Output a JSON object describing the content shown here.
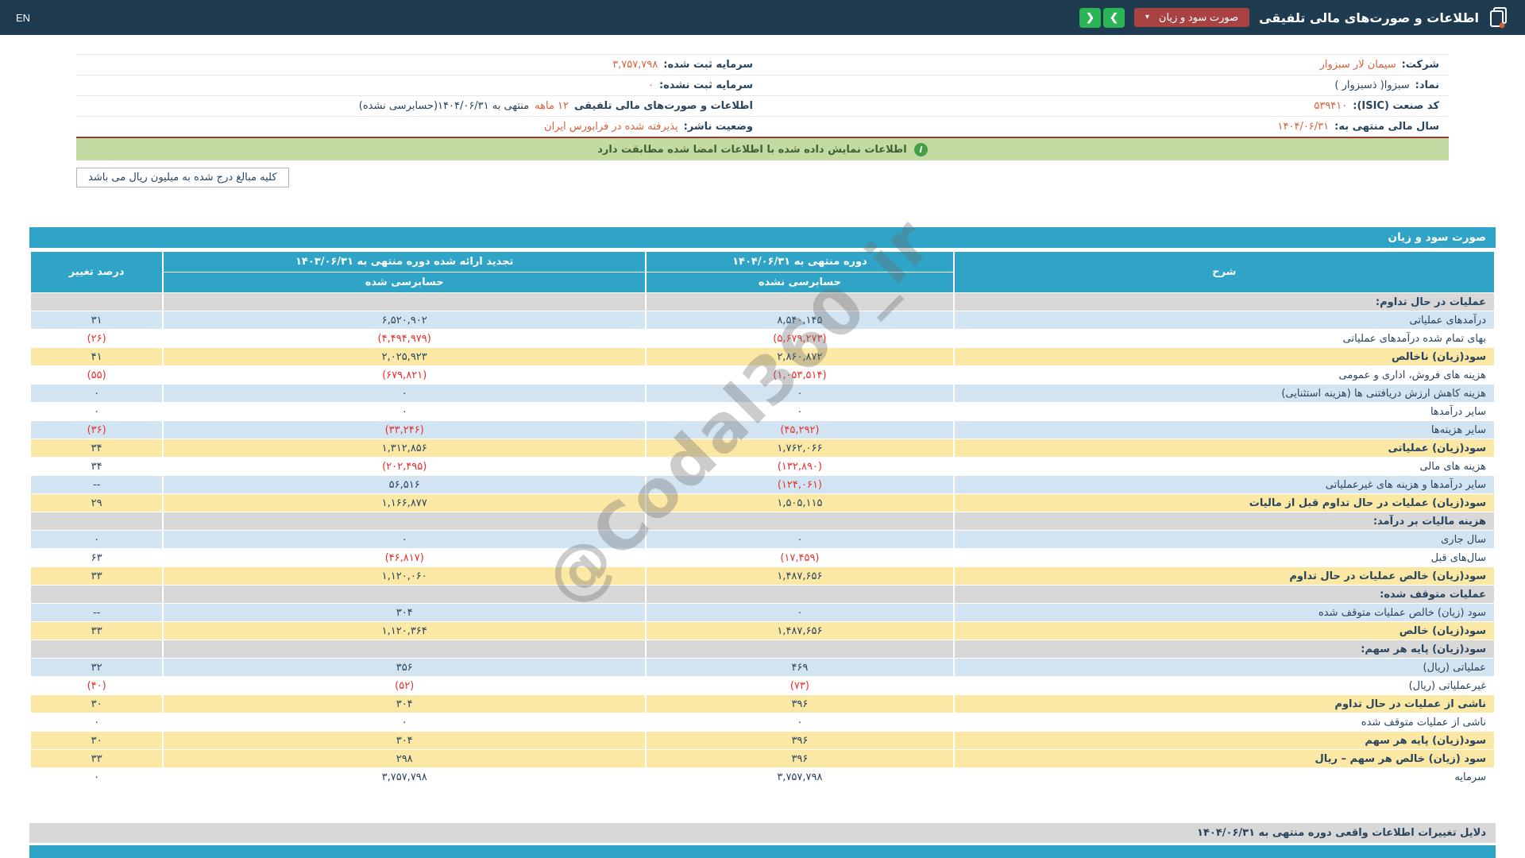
{
  "colors": {
    "topbar_bg": "#1e3b50",
    "teal": "#2fa4c6",
    "row_blue": "#d2e4f1",
    "row_yellow": "#fbe8a5",
    "row_section": "#d8d8d8",
    "neg_red": "#e5302d",
    "info_red": "#d9603b",
    "banner_bg": "#c4daa3",
    "banner_text": "#3f6132",
    "dropdown_red": "#a94343",
    "nav_green": "#2bb554"
  },
  "topbar": {
    "title": "اطلاعات و صورت‌های مالی تلفیقی",
    "dropdown_label": "صورت سود و زیان",
    "caret_icon": "▾",
    "nav": {
      "right": "❯",
      "left": "❮"
    },
    "en_label": "EN"
  },
  "company_info": {
    "company_label": "شرکت:",
    "company_value": "سیمان لار سبزوار",
    "registered_capital_label": "سرمایه ثبت شده:",
    "registered_capital_value": "۳,۷۵۷,۷۹۸",
    "symbol_label": "نماد:",
    "symbol_value": "سبزوا( ذسبزوار )",
    "unregistered_capital_label": "سرمایه ثبت نشده:",
    "unregistered_capital_value": "۰",
    "isic_label": "کد صنعت (ISIC):",
    "isic_value": "۵۳۹۴۱۰",
    "statement_label": "اطلاعات و صورت‌های مالی تلفیقی",
    "statement_period": "۱۲ ماهه",
    "statement_rest": "منتهی به ۱۴۰۴/۰۶/۳۱(حسابرسی نشده)",
    "fiscal_year_label": "سال مالی منتهی به:",
    "fiscal_year_value": "۱۴۰۴/۰۶/۳۱",
    "status_label": "وضعیت ناشر:",
    "status_value": "پذیرفته شده در فرابورس ایران"
  },
  "banner": {
    "text": "اطلاعات نمایش داده شده با اطلاعات امضا شده مطابقت دارد",
    "icon": "i"
  },
  "unit_note": "کلیه مبالغ درج شده به میلیون ریال می باشد",
  "watermark": "@Codal360_ir",
  "table": {
    "title": "صورت سود و زیان",
    "header": {
      "col_desc": "شرح",
      "col_current": "دوره منتهی به ۱۴۰۴/۰۶/۳۱",
      "col_current_sub": "حسابرسی نشده",
      "col_prior": "تجدید ارائه شده دوره منتهی به ۱۴۰۳/۰۶/۳۱",
      "col_prior_sub": "حسابرسی شده",
      "col_change": "درصد تغییر"
    },
    "rows": [
      {
        "type": "section",
        "label": "عملیات در حال تداوم:",
        "current": "",
        "prior": "",
        "change": ""
      },
      {
        "type": "blue",
        "label": "درآمدهای عملیاتی",
        "current": "۸,۵۴۰,۱۴۵",
        "prior": "۶,۵۲۰,۹۰۲",
        "change": "۳۱"
      },
      {
        "type": "white",
        "label": "بهای تمام شده درآمدهای عملیاتی",
        "current": "(۵,۶۷۹,۲۷۳)",
        "prior": "(۴,۴۹۴,۹۷۹)",
        "change": "(۲۶)"
      },
      {
        "type": "yellow",
        "label": "سود(زیان) ناخالص",
        "current": "۲,۸۶۰,۸۷۲",
        "prior": "۲,۰۲۵,۹۲۳",
        "change": "۴۱"
      },
      {
        "type": "white",
        "label": "هزینه های فروش، اداری و عمومی",
        "current": "(۱,۰۵۳,۵۱۴)",
        "prior": "(۶۷۹,۸۲۱)",
        "change": "(۵۵)"
      },
      {
        "type": "blue",
        "label": "هزینه کاهش ارزش دریافتنی ها (هزینه استثنایی)",
        "current": "۰",
        "prior": "۰",
        "change": "۰"
      },
      {
        "type": "white",
        "label": "سایر درآمدها",
        "current": "۰",
        "prior": "۰",
        "change": "۰"
      },
      {
        "type": "blue",
        "label": "سایر هزینه‌ها",
        "current": "(۴۵,۲۹۲)",
        "prior": "(۳۳,۲۴۶)",
        "change": "(۳۶)"
      },
      {
        "type": "yellow",
        "label": "سود(زیان) عملیاتی",
        "current": "۱,۷۶۲,۰۶۶",
        "prior": "۱,۳۱۲,۸۵۶",
        "change": "۳۴"
      },
      {
        "type": "white",
        "label": "هزینه های مالی",
        "current": "(۱۳۲,۸۹۰)",
        "prior": "(۲۰۲,۴۹۵)",
        "change": "۳۴"
      },
      {
        "type": "blue",
        "label": "سایر درآمدها و هزینه های غیرعملیاتی",
        "current": "(۱۲۴,۰۶۱)",
        "prior": "۵۶,۵۱۶",
        "change": "--"
      },
      {
        "type": "yellow",
        "label": "سود(زیان) عملیات در حال تداوم قبل از مالیات",
        "current": "۱,۵۰۵,۱۱۵",
        "prior": "۱,۱۶۶,۸۷۷",
        "change": "۲۹"
      },
      {
        "type": "section",
        "label": "هزینه مالیات بر درآمد:",
        "current": "",
        "prior": "",
        "change": ""
      },
      {
        "type": "blue",
        "label": "سال جاری",
        "current": "۰",
        "prior": "۰",
        "change": "۰"
      },
      {
        "type": "white",
        "label": "سال‌های قبل",
        "current": "(۱۷,۴۵۹)",
        "prior": "(۴۶,۸۱۷)",
        "change": "۶۳"
      },
      {
        "type": "yellow",
        "label": "سود(زیان) خالص عملیات در حال تداوم",
        "current": "۱,۴۸۷,۶۵۶",
        "prior": "۱,۱۲۰,۰۶۰",
        "change": "۳۳"
      },
      {
        "type": "section",
        "label": "عملیات متوقف شده:",
        "current": "",
        "prior": "",
        "change": ""
      },
      {
        "type": "blue",
        "label": "سود (زیان) خالص عملیات متوقف شده",
        "current": "۰",
        "prior": "۳۰۴",
        "change": "--"
      },
      {
        "type": "yellow",
        "label": "سود(زیان) خالص",
        "current": "۱,۴۸۷,۶۵۶",
        "prior": "۱,۱۲۰,۳۶۴",
        "change": "۳۳"
      },
      {
        "type": "section",
        "label": "سود(زیان) پایه هر سهم:",
        "current": "",
        "prior": "",
        "change": ""
      },
      {
        "type": "blue",
        "label": "عملیاتی (ریال)",
        "current": "۴۶۹",
        "prior": "۳۵۶",
        "change": "۳۲"
      },
      {
        "type": "white",
        "label": "غیرعملیاتی (ریال)",
        "current": "(۷۳)",
        "prior": "(۵۲)",
        "change": "(۴۰)"
      },
      {
        "type": "yellow",
        "label": "ناشی از عملیات در حال تداوم",
        "current": "۳۹۶",
        "prior": "۳۰۴",
        "change": "۳۰"
      },
      {
        "type": "white",
        "label": "ناشی از عملیات متوقف شده",
        "current": "۰",
        "prior": "۰",
        "change": "۰"
      },
      {
        "type": "yellow",
        "label": "سود(زیان) پایه هر سهم",
        "current": "۳۹۶",
        "prior": "۳۰۴",
        "change": "۳۰"
      },
      {
        "type": "yellow",
        "label": "سود (زیان) خالص هر سهم – ریال",
        "current": "۳۹۶",
        "prior": "۲۹۸",
        "change": "۳۳"
      },
      {
        "type": "white",
        "label": "سرمایه",
        "current": "۳,۷۵۷,۷۹۸",
        "prior": "۳,۷۵۷,۷۹۸",
        "change": "۰"
      }
    ]
  },
  "footer": {
    "reasons_label": "دلایل تغییرات اطلاعات واقعی دوره منتهی به ۱۴۰۴/۰۶/۳۱"
  }
}
